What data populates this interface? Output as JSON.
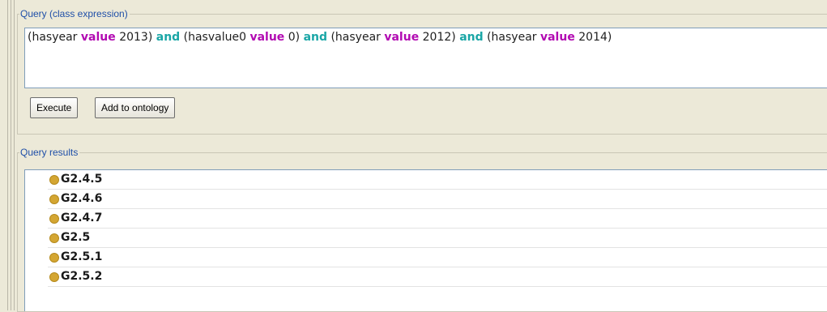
{
  "query_panel": {
    "legend": "Query (class expression)",
    "expression": [
      {
        "text": "(hasyear ",
        "kind": "plain"
      },
      {
        "text": "value",
        "kind": "value"
      },
      {
        "text": " 2013) ",
        "kind": "plain"
      },
      {
        "text": "and",
        "kind": "and"
      },
      {
        "text": " (hasvalue0 ",
        "kind": "plain"
      },
      {
        "text": "value",
        "kind": "value"
      },
      {
        "text": " 0) ",
        "kind": "plain"
      },
      {
        "text": "and",
        "kind": "and"
      },
      {
        "text": " (hasyear ",
        "kind": "plain"
      },
      {
        "text": "value",
        "kind": "value"
      },
      {
        "text": " 2012) ",
        "kind": "plain"
      },
      {
        "text": "and",
        "kind": "and"
      },
      {
        "text": " (hasyear ",
        "kind": "plain"
      },
      {
        "text": "value",
        "kind": "value"
      },
      {
        "text": " 2014)",
        "kind": "plain"
      }
    ],
    "execute_label": "Execute",
    "add_to_ontology_label": "Add to ontology"
  },
  "results_panel": {
    "legend": "Query results",
    "items": [
      {
        "label": "G2.4.5",
        "icon": "individual-dot-icon"
      },
      {
        "label": "G2.4.6",
        "icon": "individual-dot-icon"
      },
      {
        "label": "G2.4.7",
        "icon": "individual-dot-icon"
      },
      {
        "label": "G2.5",
        "icon": "individual-dot-icon"
      },
      {
        "label": "G2.5.1",
        "icon": "individual-dot-icon"
      },
      {
        "label": "G2.5.2",
        "icon": "individual-dot-icon"
      }
    ]
  },
  "colors": {
    "keyword_value": "#b20ab2",
    "keyword_and": "#1aa6a6",
    "legend": "#1f4fa8",
    "individual_dot": "#d4a632"
  }
}
